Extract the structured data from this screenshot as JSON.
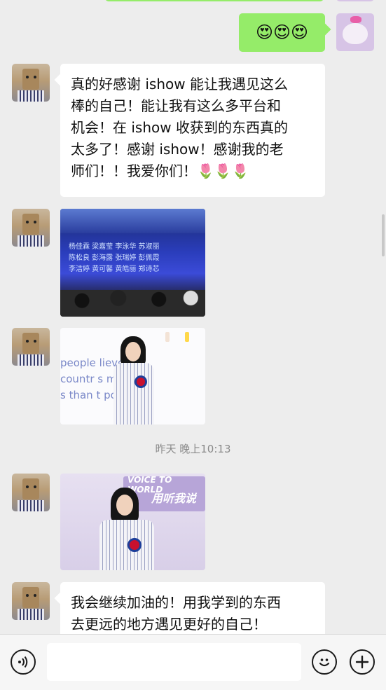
{
  "messages": {
    "m1_emoji": "😍😍😍",
    "m2_lines": [
      "真的好感谢 ishow 能让我遇见这么",
      "棒的自己！能让我有这么多平台和",
      "机会！在 ishow 收获到的东西真的",
      "太多了！感谢 ishow！感谢我的老",
      "师们！！我爱你们！🌷🌷🌷"
    ],
    "img1_screen_lines": [
      "杨佳霖  梁嘉莹  李泳华  苏淑丽",
      "陈松良  彭海露  张瑞婷  彭佩霞",
      "李洁婷  黄可馨  黄皓丽  郑诗芯"
    ],
    "img2_slide_lines": [
      "people  lieve th",
      "countr      s mor",
      "s than t     positiv"
    ],
    "img3_banner_top": "VOICE TO WORLD",
    "img3_banner_main": "用听我说",
    "timestamp": "昨天 晚上10:13",
    "m6_lines": [
      "我会继续加油的！用我学到的东西",
      "去更远的地方遇见更好的自己！"
    ]
  },
  "footer": {
    "voice_icon": "voice-wave-icon",
    "emoji_icon": "smiley-icon",
    "plus_icon": "plus-icon"
  }
}
